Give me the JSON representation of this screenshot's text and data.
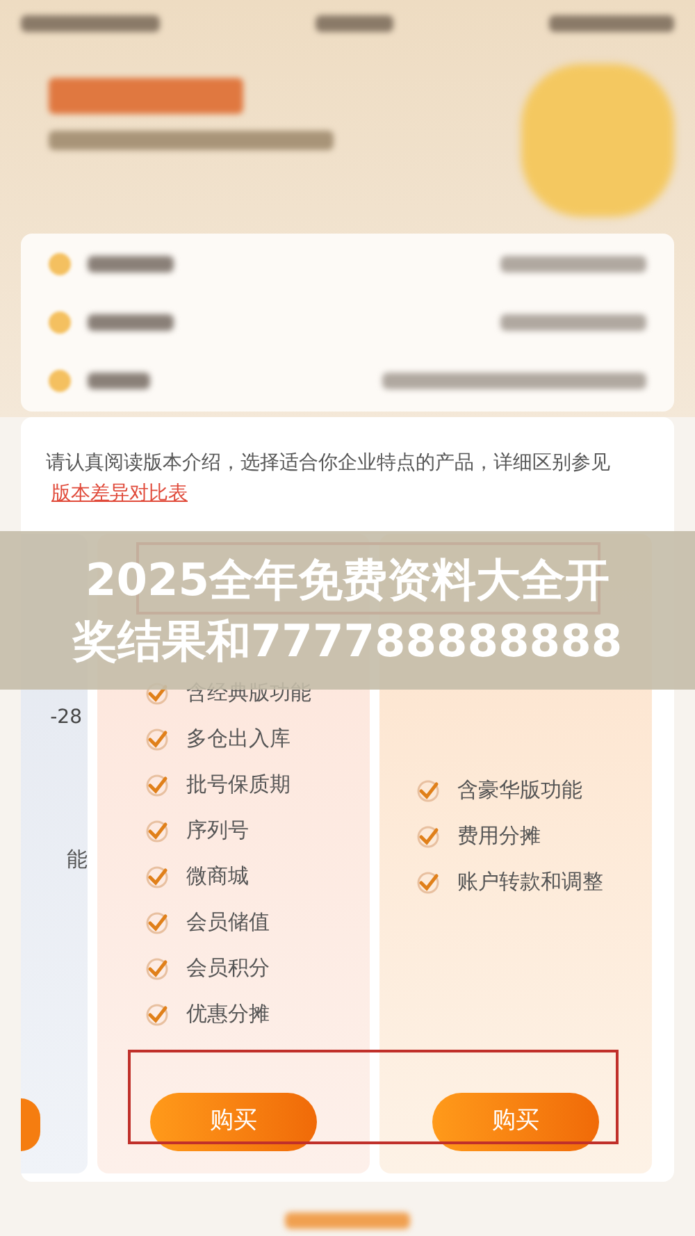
{
  "intro": {
    "text": "请认真阅读版本介绍，选择适合你企业特点的产品，详细区别参见",
    "link": "版本差异对比表"
  },
  "plans": [
    {
      "kind": "partial",
      "date": "-28",
      "features": [
        "能"
      ]
    },
    {
      "kind": "full",
      "features": [
        "含经典版功能",
        "多仓出入库",
        "批号保质期",
        "序列号",
        "微商城",
        "会员储值",
        "会员积分",
        "优惠分摊"
      ],
      "button": "购买"
    },
    {
      "kind": "full",
      "features": [
        "含豪华版功能",
        "费用分摊",
        "账户转款和调整"
      ],
      "button": "购买"
    }
  ],
  "banner": {
    "lines": [
      "2025全年免费资料大全开",
      "奖结果和777788888888"
    ]
  }
}
